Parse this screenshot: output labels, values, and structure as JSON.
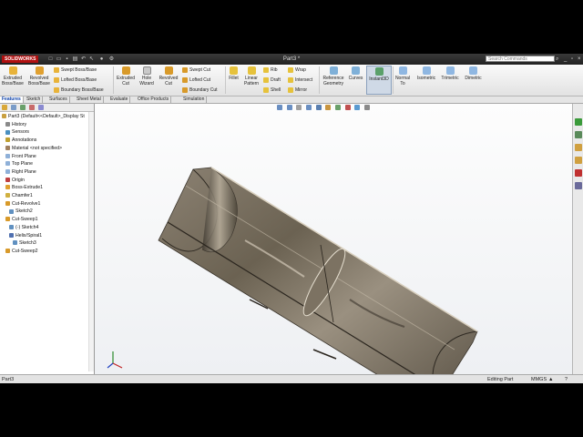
{
  "app": {
    "logo_text": "SOLIDWORKS",
    "document_title": "Part3 *",
    "search_placeholder": "Search Commands"
  },
  "ribbon": {
    "extruded_boss": "Extruded Boss/Base",
    "revolved_boss": "Revolved Boss/Base",
    "swept_boss": "Swept Boss/Base",
    "lofted_boss": "Lofted Boss/Base",
    "boundary_boss": "Boundary Boss/Base",
    "extruded_cut": "Extruded Cut",
    "hole_wizard": "Hole Wizard",
    "revolved_cut": "Revolved Cut",
    "swept_cut": "Swept Cut",
    "lofted_cut": "Lofted Cut",
    "boundary_cut": "Boundary Cut",
    "fillet": "Fillet",
    "linear_pattern": "Linear Pattern",
    "rib": "Rib",
    "draft": "Draft",
    "shell": "Shell",
    "wrap": "Wrap",
    "intersect": "Intersect",
    "mirror": "Mirror",
    "reference_geometry": "Reference Geometry",
    "curves": "Curves",
    "instant3d": "Instant3D",
    "normal_to": "Normal To",
    "isometric": "Isometric",
    "trimetric": "Trimetric",
    "dimetric": "Dimetric"
  },
  "tabs": [
    "Features",
    "Sketch",
    "Surfaces",
    "Sheet Metal",
    "Evaluate",
    "Office Products",
    "Simulation"
  ],
  "tree": [
    {
      "label": "Part3  (Default<<Default>_Display St",
      "level": 0,
      "icon": "part-icon"
    },
    {
      "label": "History",
      "level": 1,
      "icon": "history-icon"
    },
    {
      "label": "Sensors",
      "level": 1,
      "icon": "sensor-icon"
    },
    {
      "label": "Annotations",
      "level": 1,
      "icon": "annotation-icon"
    },
    {
      "label": "Material <not specified>",
      "level": 1,
      "icon": "material-icon"
    },
    {
      "label": "Front Plane",
      "level": 1,
      "icon": "plane-icon"
    },
    {
      "label": "Top Plane",
      "level": 1,
      "icon": "plane-icon"
    },
    {
      "label": "Right Plane",
      "level": 1,
      "icon": "plane-icon"
    },
    {
      "label": "Origin",
      "level": 1,
      "icon": "origin-icon"
    },
    {
      "label": "Boss-Extrude1",
      "level": 1,
      "icon": "extrude-icon"
    },
    {
      "label": "Chamfer1",
      "level": 1,
      "icon": "chamfer-icon"
    },
    {
      "label": "Cut-Revolve1",
      "level": 1,
      "icon": "cut-revolve-icon"
    },
    {
      "label": "Sketch2",
      "level": 2,
      "icon": "sketch-icon"
    },
    {
      "label": "Cut-Sweep1",
      "level": 1,
      "icon": "cut-sweep-icon"
    },
    {
      "label": "(-) Sketch4",
      "level": 2,
      "icon": "sketch-icon"
    },
    {
      "label": "Helix/Spiral1",
      "level": 2,
      "icon": "helix-icon"
    },
    {
      "label": "Sketch3",
      "level": 3,
      "icon": "sketch-icon"
    },
    {
      "label": "Cut-Sweep2",
      "level": 1,
      "icon": "cut-sweep-icon"
    }
  ],
  "status": {
    "left": "Part3",
    "mode": "Editing Part",
    "units": "MMGS"
  },
  "colors": {
    "titlebar": "#2b2b2b",
    "selection": "#cfe0f7",
    "part_body": "#6e6555"
  }
}
